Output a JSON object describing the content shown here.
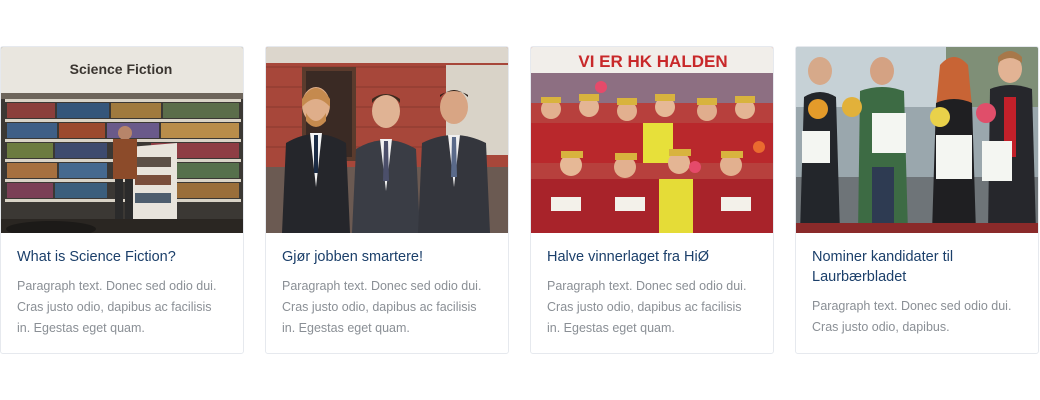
{
  "cards": [
    {
      "image_label": "Science Fiction",
      "title": "What is Science Fiction?",
      "text": "Paragraph text. Donec sed odio dui. Cras justo odio, dapibus ac facilisis in. Egestas eget quam."
    },
    {
      "title": "Gjør jobben smartere!",
      "text": "Paragraph text. Donec sed odio dui. Cras justo odio, dapibus ac facilisis in. Egestas eget quam."
    },
    {
      "image_banner": "VI ER HK HALDEN",
      "title": "Halve vinnerlaget fra HiØ",
      "text": "Paragraph text. Donec sed odio dui. Cras justo odio, dapibus ac facilisis in. Egestas eget quam."
    },
    {
      "title": "Nominer kandidater til Laurbærbladet",
      "text": "Paragraph text. Donec sed odio dui. Cras justo odio, dapibus."
    }
  ],
  "colors": {
    "title": "#1b3f6a",
    "text": "#8a8f95",
    "border": "#e6e9ee"
  }
}
